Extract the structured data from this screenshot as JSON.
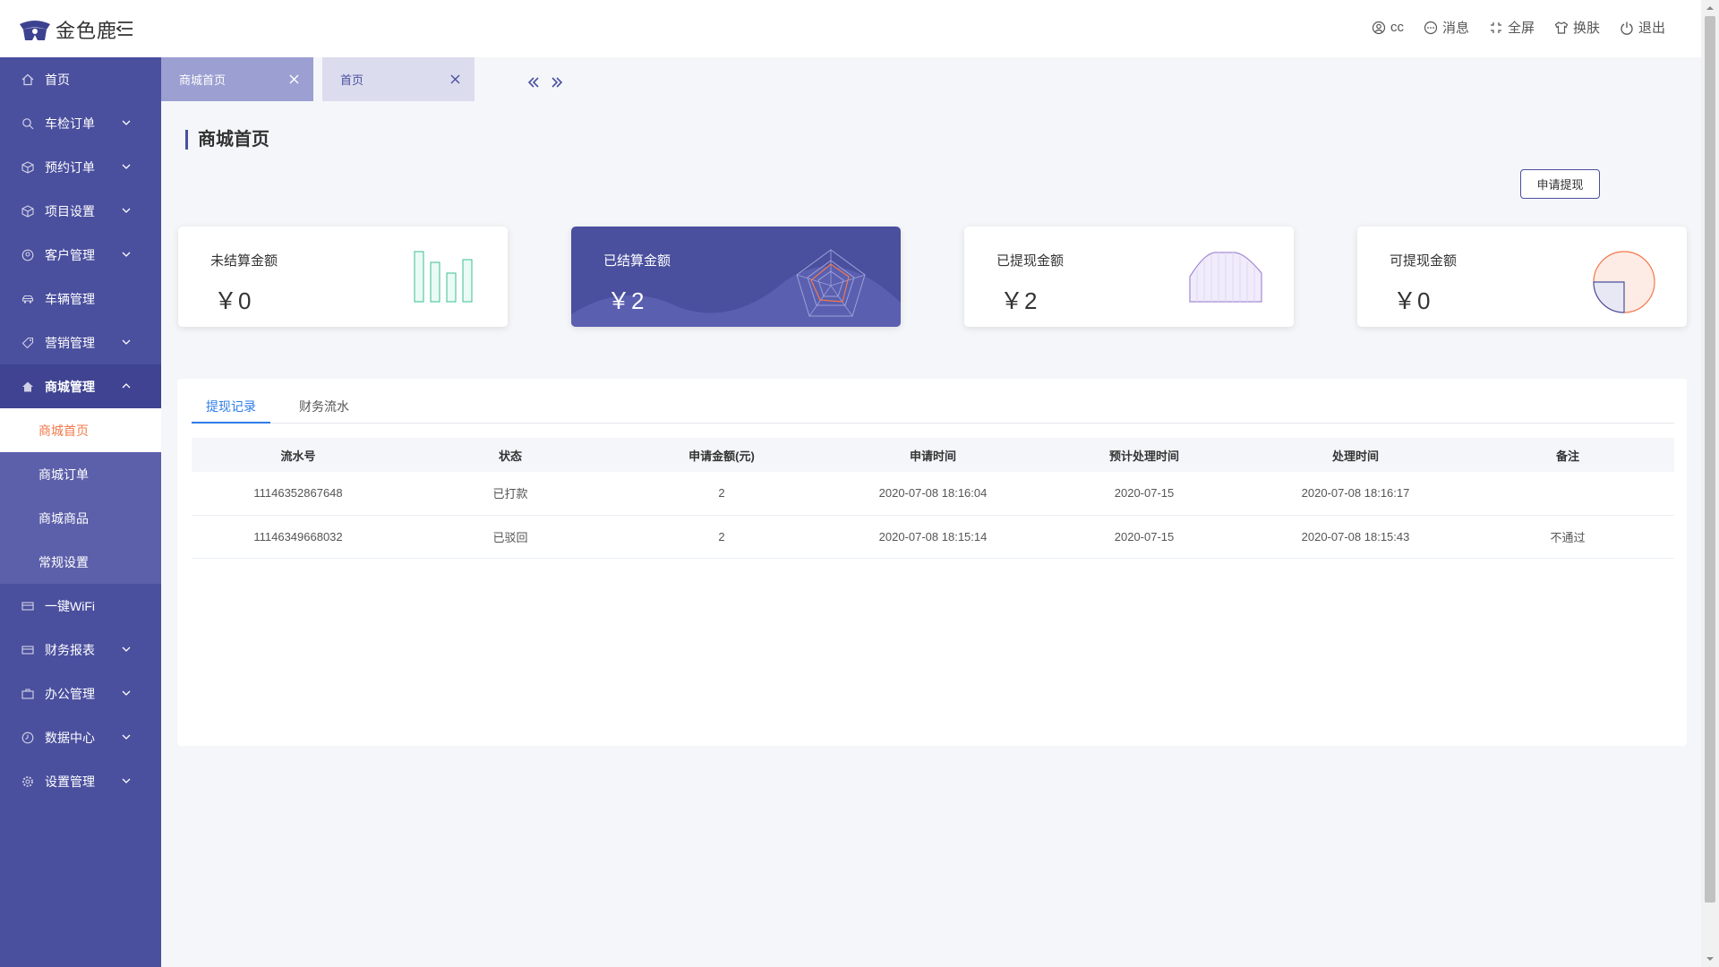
{
  "app": {
    "name": "金色鹿"
  },
  "header": {
    "user": "cc",
    "message": "消息",
    "fullscreen": "全屏",
    "skin": "换肤",
    "logout": "退出"
  },
  "sidebar": {
    "items": [
      {
        "label": "首页",
        "icon": "home-icon"
      },
      {
        "label": "车检订单",
        "icon": "search-icon",
        "expandable": true
      },
      {
        "label": "预约订单",
        "icon": "box-icon",
        "expandable": true
      },
      {
        "label": "项目设置",
        "icon": "box-icon",
        "expandable": true
      },
      {
        "label": "客户管理",
        "icon": "user-circle-icon",
        "expandable": true
      },
      {
        "label": "车辆管理",
        "icon": "car-icon"
      },
      {
        "label": "营销管理",
        "icon": "tag-icon",
        "expandable": true
      },
      {
        "label": "商城管理",
        "icon": "home-icon",
        "expandable": true,
        "open": true
      },
      {
        "label": "一键WiFi",
        "icon": "card-icon"
      },
      {
        "label": "财务报表",
        "icon": "card-icon",
        "expandable": true
      },
      {
        "label": "办公管理",
        "icon": "briefcase-icon",
        "expandable": true
      },
      {
        "label": "数据中心",
        "icon": "clock-icon",
        "expandable": true
      },
      {
        "label": "设置管理",
        "icon": "gear-icon",
        "expandable": true
      }
    ],
    "submenu": [
      "商城首页",
      "商城订单",
      "商城商品",
      "常规设置"
    ],
    "active_sub": "商城首页"
  },
  "tabs": [
    {
      "label": "商城首页",
      "active": true
    },
    {
      "label": "首页",
      "active": false
    }
  ],
  "page": {
    "title": "商城首页",
    "apply_button": "申请提现"
  },
  "cards": [
    {
      "label": "未结算金额",
      "value": "￥0",
      "icon": "bar-chart-icon"
    },
    {
      "label": "已结算金额",
      "value": "￥2",
      "icon": "radar-chart-icon",
      "highlighted": true
    },
    {
      "label": "已提现金额",
      "value": "￥2",
      "icon": "area-chart-icon"
    },
    {
      "label": "可提现金额",
      "value": "￥0",
      "icon": "pie-chart-icon"
    }
  ],
  "records": {
    "tabs": [
      "提现记录",
      "财务流水"
    ],
    "active_tab": "提现记录",
    "columns": [
      "流水号",
      "状态",
      "申请金额(元)",
      "申请时间",
      "预计处理时间",
      "处理时间",
      "备注"
    ],
    "rows": [
      [
        "11146352867648",
        "已打款",
        "2",
        "2020-07-08 18:16:04",
        "2020-07-15",
        "2020-07-08 18:16:17",
        ""
      ],
      [
        "11146349668032",
        "已驳回",
        "2",
        "2020-07-08 18:15:14",
        "2020-07-15",
        "2020-07-08 18:15:43",
        "不通过"
      ]
    ]
  },
  "colors": {
    "primary": "#4a4f9e",
    "active_text": "#f2784b",
    "link_blue": "#2e7ce8"
  }
}
